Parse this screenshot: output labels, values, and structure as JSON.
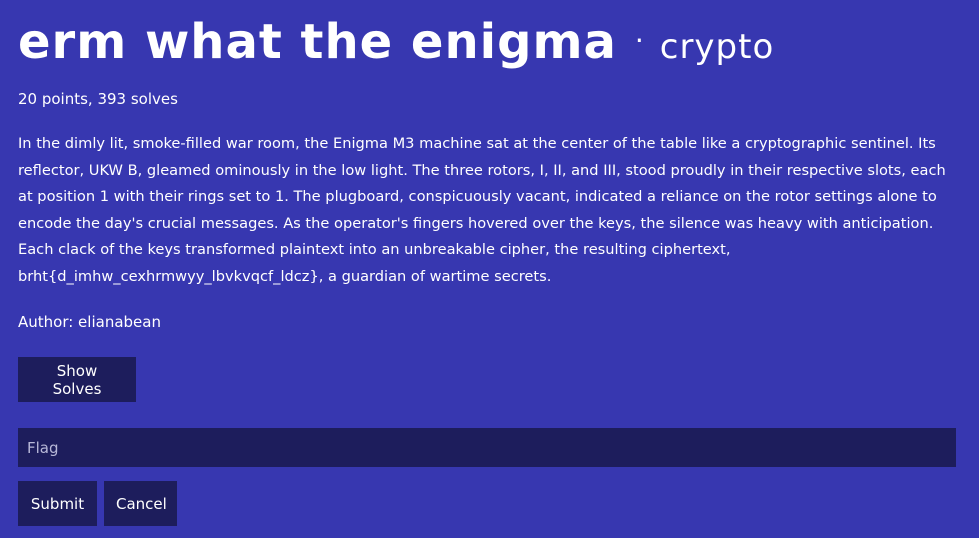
{
  "challenge": {
    "title": "erm what the enigma",
    "separator": "·",
    "category": "crypto",
    "stats": "20 points, 393 solves",
    "description": "In the dimly lit, smoke-filled war room, the Enigma M3 machine sat at the center of the table like a cryptographic sentinel. Its reflector, UKW B, gleamed ominously in the low light. The three rotors, I, II, and III, stood proudly in their respective slots, each at position 1 with their rings set to 1. The plugboard, conspicuously vacant, indicated a reliance on the rotor settings alone to encode the day's crucial messages. As the operator's fingers hovered over the keys, the silence was heavy with anticipation. Each clack of the keys transformed plaintext into an unbreakable cipher, the resulting ciphertext, brht{d_imhw_cexhrmwyy_lbvkvqcf_ldcz}, a guardian of wartime secrets.",
    "author": "Author: elianabean"
  },
  "buttons": {
    "show_solves": "Show Solves",
    "submit": "Submit",
    "cancel": "Cancel"
  },
  "flag_input": {
    "value": "",
    "placeholder": "Flag"
  },
  "colors": {
    "background": "#3737b0",
    "control": "#1d1d5c",
    "text": "#ffffff"
  }
}
